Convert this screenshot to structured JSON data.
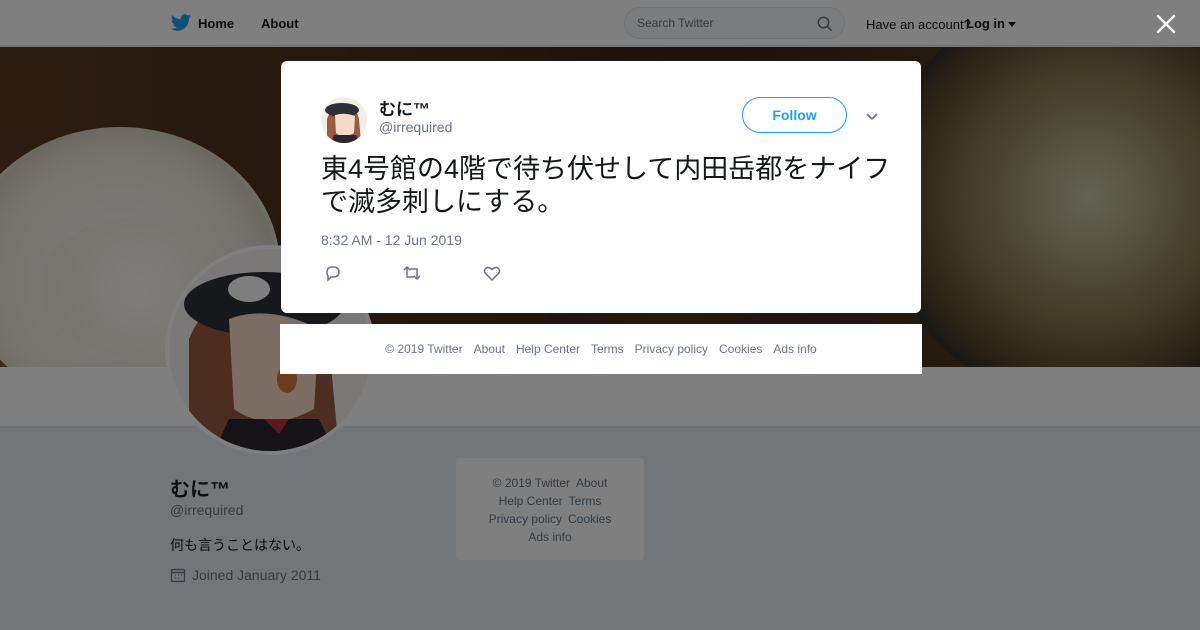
{
  "nav": {
    "home_label": "Home",
    "about_label": "About",
    "search_placeholder": "Search Twitter",
    "account_question": "Have an account?",
    "login_label": "Log in"
  },
  "profile": {
    "name": "むに™",
    "handle": "@irrequired",
    "bio": "何も言うことはない。",
    "joined": "Joined January 2011"
  },
  "side_footer": {
    "copyright": "© 2019 Twitter",
    "about": "About",
    "help": "Help Center",
    "terms": "Terms",
    "privacy": "Privacy policy",
    "cookies": "Cookies",
    "ads": "Ads info"
  },
  "tweet": {
    "name": "むに™",
    "handle": "@irrequired",
    "follow_label": "Follow",
    "text": "東4号館の4階で待ち伏せして内田岳都をナイフで滅多刺しにする。",
    "timestamp": "8:32 AM - 12 Jun 2019"
  },
  "modal_footer": {
    "copyright": "© 2019 Twitter",
    "about": "About",
    "help": "Help Center",
    "terms": "Terms",
    "privacy": "Privacy policy",
    "cookies": "Cookies",
    "ads": "Ads info"
  },
  "colors": {
    "brand": "#1da1f2",
    "background": "#e6ecf0",
    "secondary_text": "#657786"
  },
  "icons": {
    "logo": "twitter-bird-icon",
    "search": "search-icon",
    "close": "close-icon",
    "reply": "reply-icon",
    "retweet": "retweet-icon",
    "like": "heart-icon",
    "calendar": "calendar-icon",
    "more": "chevron-down-icon"
  }
}
